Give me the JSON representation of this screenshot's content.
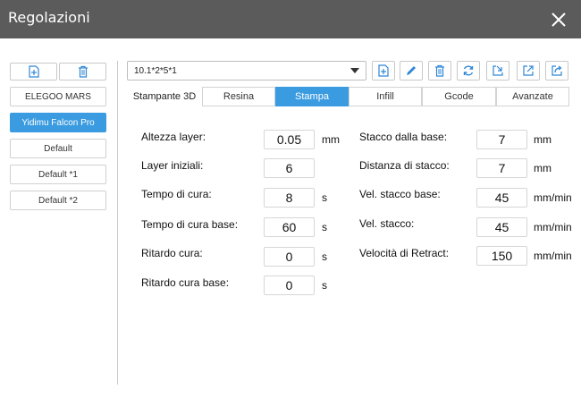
{
  "window": {
    "title": "Regolazioni"
  },
  "sidebar": {
    "items": [
      {
        "label": "ELEGOO MARS",
        "active": false
      },
      {
        "label": "Yidimu Falcon Pro",
        "active": true
      },
      {
        "label": "Default",
        "active": false
      },
      {
        "label": "Default *1",
        "active": false
      },
      {
        "label": "Default *2",
        "active": false
      }
    ]
  },
  "profile_select": {
    "value": "10.1*2*5*1"
  },
  "toolbar": {
    "icons": [
      "add-file-icon",
      "edit-pencil-icon",
      "delete-trash-icon",
      "refresh-icon",
      "import-icon",
      "export-icon",
      "share-icon"
    ]
  },
  "tabs": {
    "first": "Stampante 3D",
    "items": [
      {
        "label": "Resina",
        "active": false
      },
      {
        "label": "Stampa",
        "active": true
      },
      {
        "label": "Infill",
        "active": false
      },
      {
        "label": "Gcode",
        "active": false
      },
      {
        "label": "Avanzate",
        "active": false
      }
    ]
  },
  "settings_left": [
    {
      "label": "Altezza layer:",
      "value": "0.05",
      "unit": "mm"
    },
    {
      "label": "Layer iniziali:",
      "value": "6",
      "unit": ""
    },
    {
      "label": "Tempo di cura:",
      "value": "8",
      "unit": "s"
    },
    {
      "label": "Tempo di cura base:",
      "value": "60",
      "unit": "s"
    },
    {
      "label": "Ritardo cura:",
      "value": "0",
      "unit": "s"
    },
    {
      "label": "Ritardo cura base:",
      "value": "0",
      "unit": "s"
    }
  ],
  "settings_right": [
    {
      "label": "Stacco dalla base:",
      "value": "7",
      "unit": "mm"
    },
    {
      "label": "Distanza di stacco:",
      "value": "7",
      "unit": "mm"
    },
    {
      "label": "Vel. stacco base:",
      "value": "45",
      "unit": "mm/min"
    },
    {
      "label": "Vel. stacco:",
      "value": "45",
      "unit": "mm/min"
    },
    {
      "label": "Velocità di Retract:",
      "value": "150",
      "unit": "mm/min"
    }
  ],
  "colors": {
    "titlebar": "#5b5b5b",
    "accent": "#3a9be0",
    "icon_blue": "#2f86d6"
  }
}
